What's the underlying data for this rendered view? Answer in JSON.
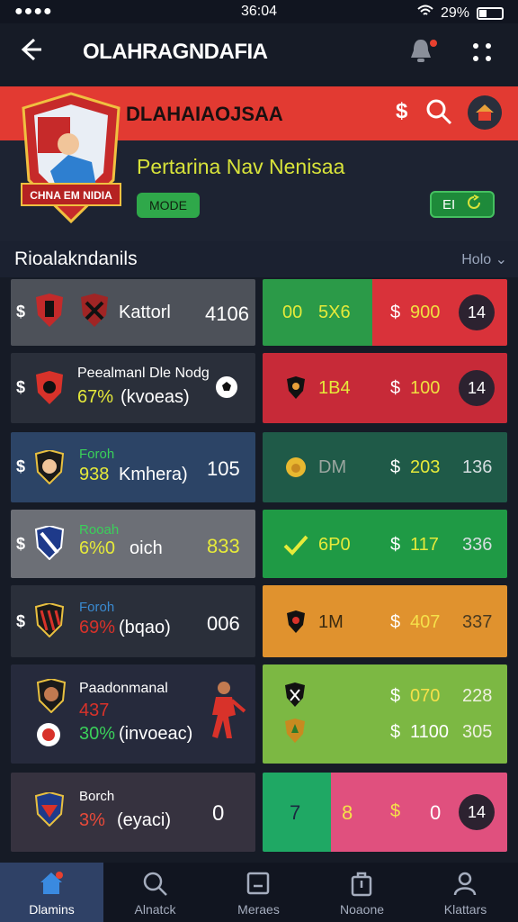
{
  "status": {
    "signal": "●●●●",
    "time": "36:04",
    "battery": "29%"
  },
  "header": {
    "title": "OLAHRAGNDAFIA"
  },
  "hero": {
    "name": "DLAHAIAOJSAA",
    "dollar": "$",
    "crest_text": "CHNA EM NIDIA",
    "subtitle": "Pertarina Nav Nenisaa",
    "mode_button": "MODE",
    "right_button": "EI"
  },
  "section": {
    "title": "Rioalakndanils",
    "more": "Holo"
  },
  "rows": [
    {
      "sym": "$",
      "name": "Kattorl",
      "value": "4106",
      "r1": "00",
      "r2": "5X6",
      "price_sym": "$",
      "price": "900",
      "badge": "14"
    },
    {
      "sym": "$",
      "name": "Peealmanl Dle Nodg",
      "pct": "67%",
      "sub": "(kvoeas)",
      "r2": "1B4",
      "price_sym": "$",
      "price": "100",
      "badge": "14"
    },
    {
      "sym": "$",
      "label": "Foroh",
      "pct": "938",
      "sub": "Kmhera)",
      "value": "105",
      "r2": "DM",
      "price_sym": "$",
      "price": "203",
      "extra": "136"
    },
    {
      "sym": "$",
      "label": "Rooah",
      "pct": "6%0",
      "sub": "oich",
      "value": "833",
      "r2": "6P0",
      "price_sym": "$",
      "price": "117",
      "extra": "336"
    },
    {
      "sym": "$",
      "label": "Foroh",
      "pct": "69%",
      "sub": "(bqao)",
      "value": "006",
      "r2": "1M",
      "price_sym": "$",
      "price": "407",
      "extra": "337"
    },
    {
      "name": "Paadonmanal",
      "pct1": "437",
      "pct": "30%",
      "sub": "(invoeac)",
      "p1_sym": "$",
      "p1": "070",
      "e1": "228",
      "p2_sym": "$",
      "p2": "1100",
      "e2": "305"
    },
    {
      "label": "Borch",
      "pct": "3%",
      "sub": "(eyaci)",
      "value": "0",
      "r1": "7",
      "r2": "8",
      "price_sym": "$",
      "price": "0",
      "badge": "14"
    }
  ],
  "nav": [
    {
      "label": "Dlamins",
      "icon": "home-icon"
    },
    {
      "label": "Alnatck",
      "icon": "search-icon"
    },
    {
      "label": "Meraes",
      "icon": "box-icon"
    },
    {
      "label": "Noaone",
      "icon": "bag-icon"
    },
    {
      "label": "Klattars",
      "icon": "profile-icon"
    }
  ],
  "colors": {
    "accent": "#e23a32",
    "yellow": "#d8e33a",
    "green": "#2fa84a",
    "nav_active": "#2f4166"
  }
}
